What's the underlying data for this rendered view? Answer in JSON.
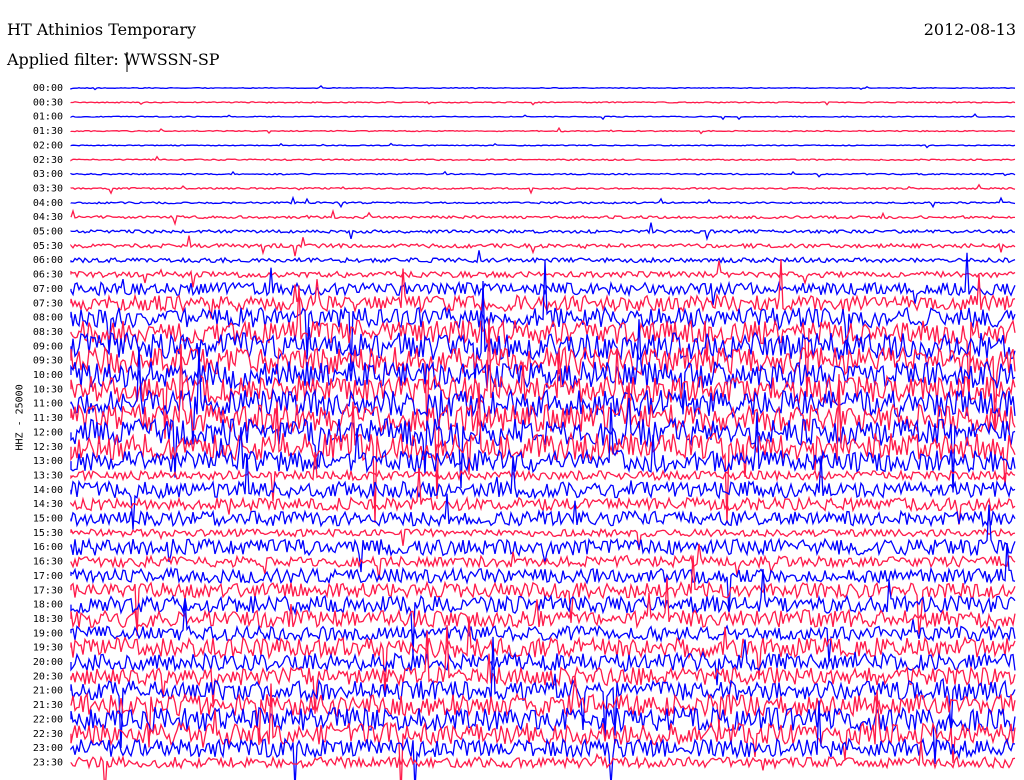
{
  "header": {
    "station": "HT Athinios Temporary",
    "date": "2012-08-13",
    "filter_label": "Applied filter:",
    "filter_value": "WWSSN-SP"
  },
  "channel_label": "HHZ - 25000",
  "colors": {
    "trace_a": "#0000ff",
    "trace_b": "#ff1a4a",
    "background": "#ffffff"
  },
  "chart_data": {
    "type": "helicorder",
    "row_labels": [
      "00:00",
      "00:30",
      "01:00",
      "01:30",
      "02:00",
      "02:30",
      "03:00",
      "03:30",
      "04:00",
      "04:30",
      "05:00",
      "05:30",
      "06:00",
      "06:30",
      "07:00",
      "07:30",
      "08:00",
      "08:30",
      "09:00",
      "09:30",
      "10:00",
      "10:30",
      "11:00",
      "11:30",
      "12:00",
      "12:30",
      "13:00",
      "13:30",
      "14:00",
      "14:30",
      "15:00",
      "15:30",
      "16:00",
      "16:30",
      "17:00",
      "17:30",
      "18:00",
      "18:30",
      "19:00",
      "19:30",
      "20:00",
      "20:30",
      "21:00",
      "21:30",
      "22:00",
      "22:30",
      "23:00",
      "23:30"
    ],
    "trace_colors": [
      "#0000ff",
      "#ff1a4a"
    ],
    "row_noise_level": [
      0.08,
      0.12,
      0.1,
      0.12,
      0.1,
      0.15,
      0.15,
      0.18,
      0.2,
      0.3,
      0.35,
      0.45,
      0.5,
      0.65,
      1.4,
      1.8,
      2.2,
      2.6,
      3.0,
      3.0,
      3.0,
      3.0,
      3.0,
      3.0,
      3.0,
      3.0,
      2.4,
      1.0,
      1.8,
      1.4,
      1.6,
      0.8,
      1.8,
      1.2,
      1.6,
      1.7,
      1.9,
      1.9,
      1.6,
      2.2,
      1.9,
      2.0,
      2.2,
      2.4,
      2.6,
      2.4,
      2.0,
      1.2
    ]
  }
}
